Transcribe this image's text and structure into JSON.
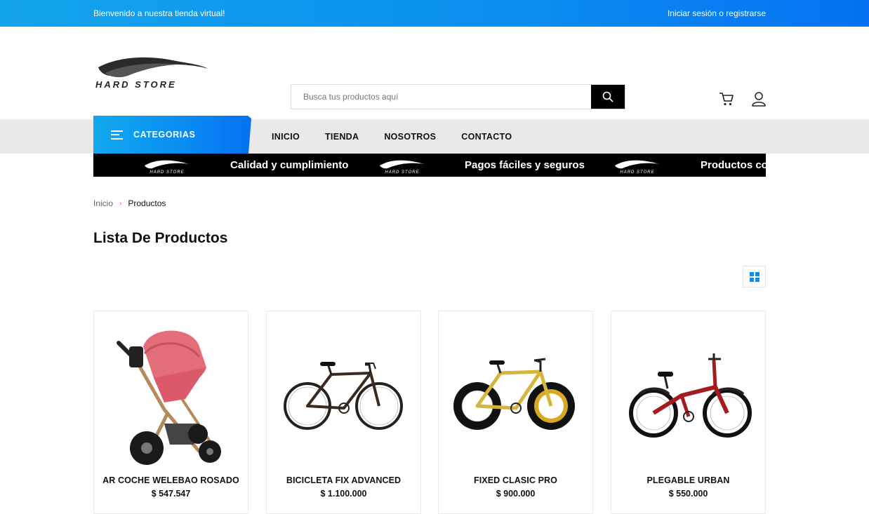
{
  "topbar": {
    "welcome": "Bienvenido a nuestra tienda virtual!",
    "login": "Iniciar sesión o registrarse"
  },
  "header": {
    "logo_text": "HARD STORE",
    "search_placeholder": "Busca tus productos aquí",
    "search_icon": "search-icon",
    "cart_icon": "cart-icon",
    "user_icon": "user-icon"
  },
  "nav": {
    "categories_label": "CATEGORIAS",
    "links": [
      "INICIO",
      "TIENDA",
      "NOSOTROS",
      "CONTACTO"
    ]
  },
  "strip": {
    "logo_text": "HARD STORE",
    "messages": [
      "Calidad y cumplimiento",
      "Pagos fáciles y seguros",
      "Productos con"
    ]
  },
  "breadcrumb": {
    "home": "Inicio",
    "separator": "›",
    "current": "Productos"
  },
  "page_title": "Lista De Productos",
  "colors": {
    "accent_blue": "#0a8ef0",
    "strip_bg": "#000000",
    "nav_bg": "#e9e9e9"
  },
  "products": [
    {
      "name": "AR COCHE WELEBAO ROSADO",
      "price": "$ 547.547",
      "image": "pink-baby-stroller"
    },
    {
      "name": "BICICLETA FIX ADVANCED",
      "price": "$ 1.100.000",
      "image": "dark-brown-road-bike"
    },
    {
      "name": "FIXED CLASIC PRO",
      "price": "$ 900.000",
      "image": "yellow-fixed-bike"
    },
    {
      "name": "PLEGABLE URBAN",
      "price": "$ 550.000",
      "image": "red-folding-bike"
    }
  ]
}
